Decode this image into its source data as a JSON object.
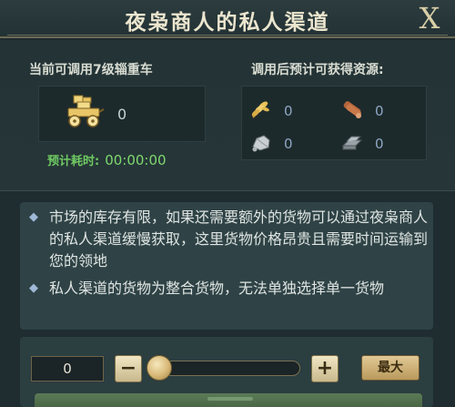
{
  "window": {
    "title": "夜枭商人的私人渠道",
    "close_label": "X"
  },
  "cart": {
    "label": "当前可调用7级辎重车",
    "count": "0",
    "icon": "wagon-icon"
  },
  "resources": {
    "label": "调用后预计可获得资源:",
    "items": [
      {
        "icon": "wheat-icon",
        "value": "0"
      },
      {
        "icon": "wood-icon",
        "value": "0"
      },
      {
        "icon": "stone-icon",
        "value": "0"
      },
      {
        "icon": "iron-icon",
        "value": "0"
      }
    ]
  },
  "eta": {
    "label": "预计耗时:",
    "time": "00:00:00"
  },
  "info": {
    "bullet_glyph": "◆",
    "paragraphs": [
      "市场的库存有限，如果还需要额外的货物可以通过夜枭商人的私人渠道缓慢获取，这里货物价格昂贵且需要时间运输到您的领地",
      "私人渠道的货物为整合货物，无法单独选择单一货物"
    ]
  },
  "controls": {
    "quantity": "0",
    "minus_label": "−",
    "plus_label": "+",
    "max_label": "最大",
    "slider_level": 0
  },
  "colors": {
    "accent_gold": "#d8b877",
    "eta_green": "#7fd86f",
    "resource_value": "#8ea7c4"
  }
}
